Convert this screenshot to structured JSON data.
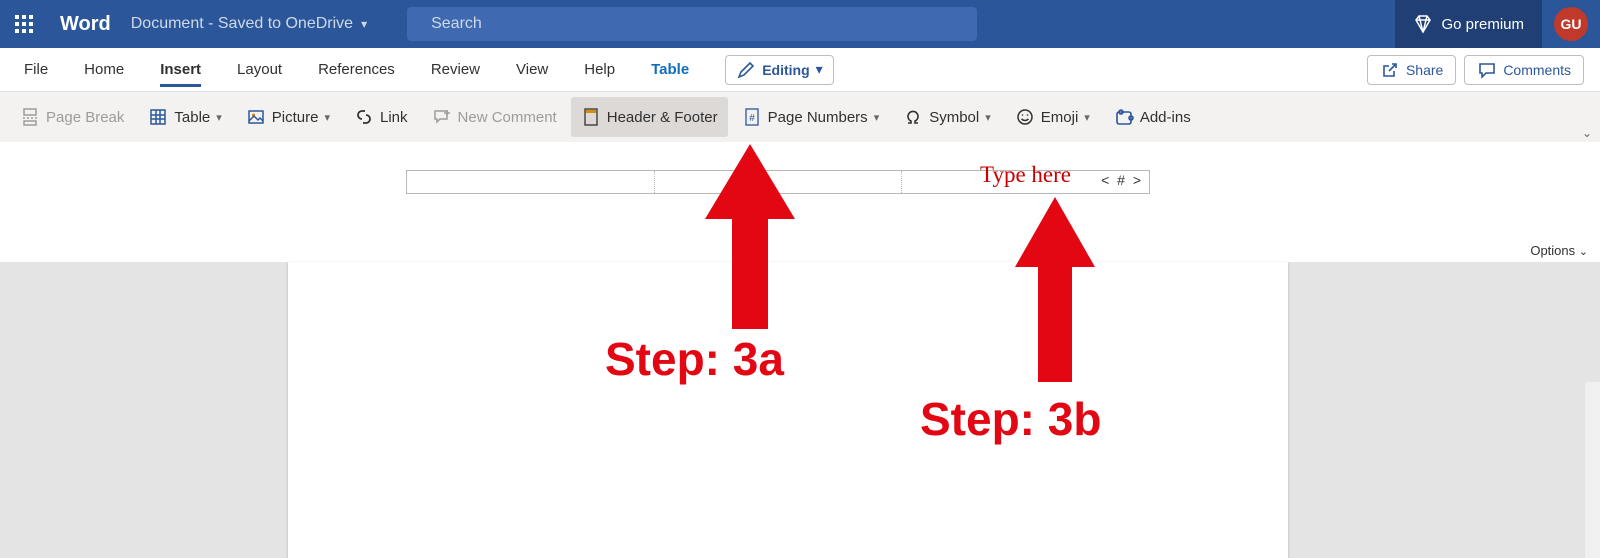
{
  "titlebar": {
    "app_name": "Word",
    "breadcrumb": "Document - Saved to OneDrive",
    "search_placeholder": "Search",
    "go_premium": "Go premium",
    "user_initials": "GU"
  },
  "tabs": {
    "items": [
      {
        "label": "File",
        "active": false
      },
      {
        "label": "Home",
        "active": false
      },
      {
        "label": "Insert",
        "active": true
      },
      {
        "label": "Layout",
        "active": false
      },
      {
        "label": "References",
        "active": false
      },
      {
        "label": "Review",
        "active": false
      },
      {
        "label": "View",
        "active": false
      },
      {
        "label": "Help",
        "active": false
      },
      {
        "label": "Table",
        "active": false,
        "context": true
      }
    ],
    "editing_label": "Editing",
    "share_label": "Share",
    "comments_label": "Comments"
  },
  "ribbon": {
    "page_break": "Page Break",
    "table": "Table",
    "picture": "Picture",
    "link": "Link",
    "new_comment": "New Comment",
    "header_footer": "Header & Footer",
    "page_numbers": "Page Numbers",
    "symbol": "Symbol",
    "emoji": "Emoji",
    "addins": "Add-ins"
  },
  "header_area": {
    "page_number_placeholder": "< # >",
    "options_label": "Options"
  },
  "annotations": {
    "type_here": "Type here",
    "step_a": "Step: 3a",
    "step_b": "Step: 3b"
  }
}
